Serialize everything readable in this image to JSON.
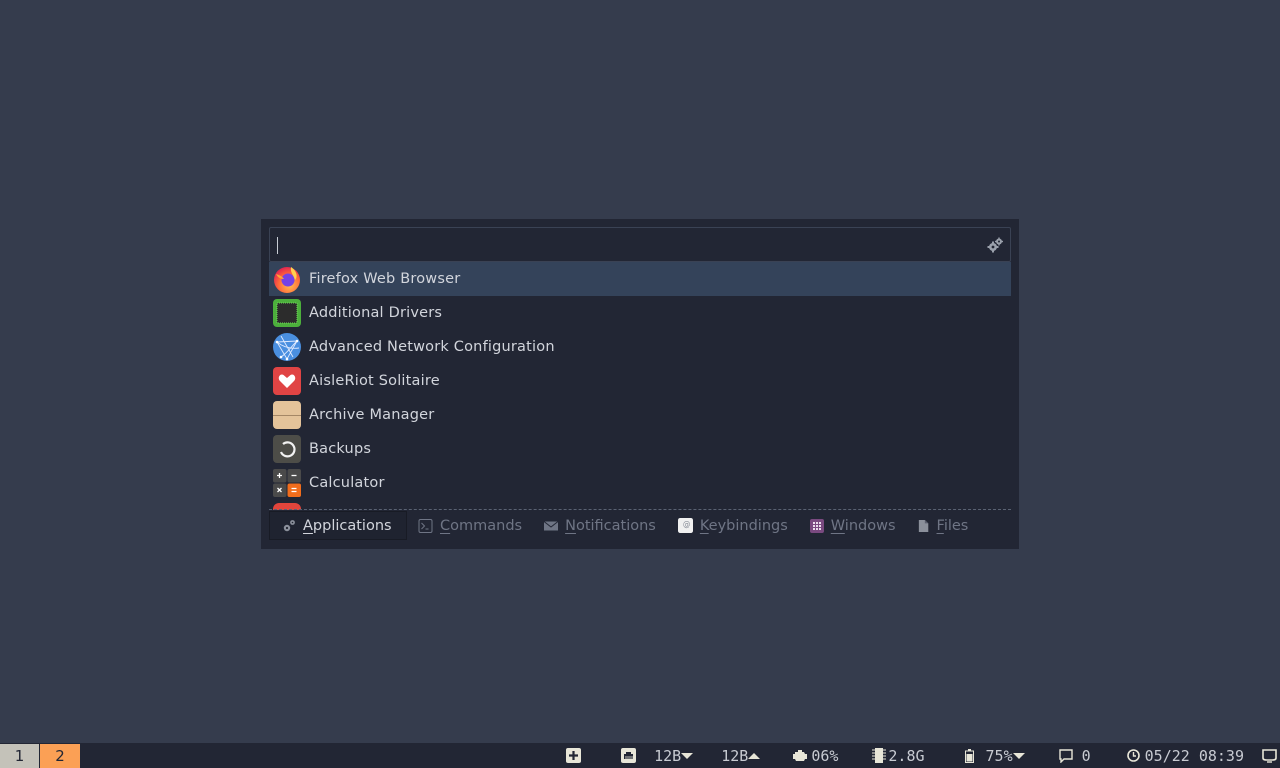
{
  "launcher": {
    "search": {
      "value": "",
      "placeholder": ""
    },
    "settings_icon": "gears-icon",
    "items": [
      {
        "label": "Firefox Web Browser",
        "icon": "firefox-icon",
        "selected": true
      },
      {
        "label": "Additional Drivers",
        "icon": "chip-icon",
        "selected": false
      },
      {
        "label": "Advanced Network Configuration",
        "icon": "network-globe-icon",
        "selected": false
      },
      {
        "label": "AisleRiot Solitaire",
        "icon": "heart-card-icon",
        "selected": false
      },
      {
        "label": "Archive Manager",
        "icon": "archive-box-icon",
        "selected": false
      },
      {
        "label": "Backups",
        "icon": "backup-circle-icon",
        "selected": false
      },
      {
        "label": "Calculator",
        "icon": "calculator-icon",
        "selected": false
      }
    ],
    "tabs": [
      {
        "accel": "A",
        "rest": "pplications",
        "icon": "gears-icon",
        "active": true
      },
      {
        "accel": "C",
        "rest": "ommands",
        "icon": "terminal-icon",
        "active": false
      },
      {
        "accel": "N",
        "rest": "otifications",
        "icon": "envelope-icon",
        "active": false
      },
      {
        "accel": "K",
        "rest": "eybindings",
        "icon": "keyboard-key-icon",
        "active": false
      },
      {
        "accel": "W",
        "rest": "indows",
        "icon": "windows-grid-icon",
        "active": false
      },
      {
        "accel": "F",
        "rest": "iles",
        "icon": "file-icon",
        "active": false
      }
    ]
  },
  "taskbar": {
    "workspaces": [
      {
        "label": "1",
        "active": false
      },
      {
        "label": "2",
        "active": true
      }
    ],
    "tray": {
      "net_down": "12B",
      "net_up": "12B",
      "cpu": "06%",
      "memory": "2.8G",
      "battery": "75%",
      "notifications_count": "0",
      "datetime": "05/22 08:39"
    },
    "colors": {
      "ws_active": "#fba055",
      "ws_inactive": "#c4c2b9"
    }
  }
}
